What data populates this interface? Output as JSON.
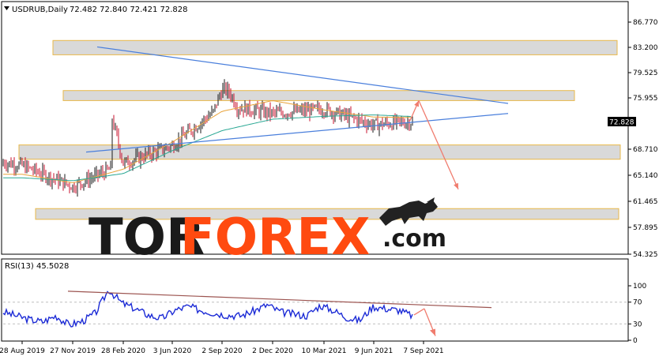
{
  "chart_data": {
    "type": "line",
    "header": {
      "symbol_timeframe": "USDRUB,Daily",
      "ohlc": "72.482 72.840 72.421 72.828"
    },
    "price_axis": {
      "ylim": [
        54.325,
        86.77
      ],
      "ticks": [
        "86.770",
        "83.200",
        "79.525",
        "75.955",
        "68.710",
        "65.140",
        "61.465",
        "57.895",
        "54.325"
      ],
      "current_price_label": "72.828",
      "current_price": 72.828
    },
    "x_ticks": [
      "28 Aug 2019",
      "27 Nov 2019",
      "28 Feb 2020",
      "3 Jun 2020",
      "2 Sep 2020",
      "2 Dec 2020",
      "10 Mar 2021",
      "9 Jun 2021",
      "7 Sep 2021"
    ],
    "price_series": {
      "name": "",
      "x": [
        "28 Aug 2019",
        "27 Nov 2019",
        "28 Feb 2020",
        "3 Jun 2020",
        "2 Sep 2020",
        "2 Dec 2020",
        "10 Mar 2021",
        "9 Jun 2021",
        "7 Sep 2021"
      ],
      "values": [
        66.7,
        63.8,
        67.0,
        69.5,
        75.2,
        74.0,
        74.6,
        72.4,
        73.0
      ]
    },
    "moving_averages": [
      {
        "name": "",
        "color": "#e8a33a",
        "values": [
          65.5,
          64.3,
          66.2,
          70.0,
          74.3,
          75.8,
          74.5,
          73.5,
          73.4
        ]
      },
      {
        "name": "",
        "color": "#2aa894",
        "values": [
          65.0,
          64.6,
          65.6,
          68.8,
          71.6,
          73.2,
          73.6,
          73.8,
          73.5
        ]
      }
    ],
    "support_resistance_zones": [
      {
        "from": 82.2,
        "to": 84.2
      },
      {
        "from": 75.8,
        "to": 77.2
      },
      {
        "from": 67.6,
        "to": 69.6
      },
      {
        "from": 59.2,
        "to": 60.7
      }
    ],
    "trendlines": [
      {
        "from": {
          "x": "28 Feb 2020",
          "y": 83.3
        },
        "to": {
          "x": "7 Sep 2021",
          "y": 75.4
        },
        "color": "#4a7fdc"
      },
      {
        "from": {
          "x": "27 Nov 2019",
          "y": 68.6
        },
        "to": {
          "x": "7 Sep 2021",
          "y": 74.0
        },
        "color": "#4a7fdc"
      }
    ],
    "forecast_arrows": [
      {
        "from": {
          "x": "7 Sep 2021",
          "y": 73.0
        },
        "to": {
          "x": "7 Sep 2021",
          "y": 75.8
        },
        "color": "#f07c6e"
      },
      {
        "from": {
          "x": "7 Sep 2021",
          "y": 75.8
        },
        "to": {
          "x": "7 Sep 2021",
          "y": 63.4
        },
        "color": "#f07c6e"
      }
    ],
    "rsi": {
      "label": "RSI(13) 45.5028",
      "ylim": [
        0,
        100
      ],
      "ticks": [
        "100",
        "70",
        "30",
        "0"
      ],
      "levels": [
        70,
        30
      ],
      "values": [
        52,
        45,
        38,
        34,
        45,
        28,
        35,
        50,
        93,
        68,
        58,
        46,
        40,
        55,
        62,
        55,
        50,
        46,
        45,
        54,
        65,
        52,
        48,
        45,
        64,
        55,
        42,
        36,
        62,
        58,
        55,
        45
      ],
      "trendline": {
        "from": 90,
        "to": 60
      },
      "arrow": {
        "from": 58,
        "to": 8
      },
      "line_color": "#1c2bd6",
      "trend_color": "#9c5450",
      "arrow_color": "#f07c6e"
    },
    "watermark": {
      "part1": "TOR",
      "part2": "FOREX",
      "part3": ".com",
      "color1": "#1a1a1a",
      "color2": "#ff4a10"
    }
  }
}
